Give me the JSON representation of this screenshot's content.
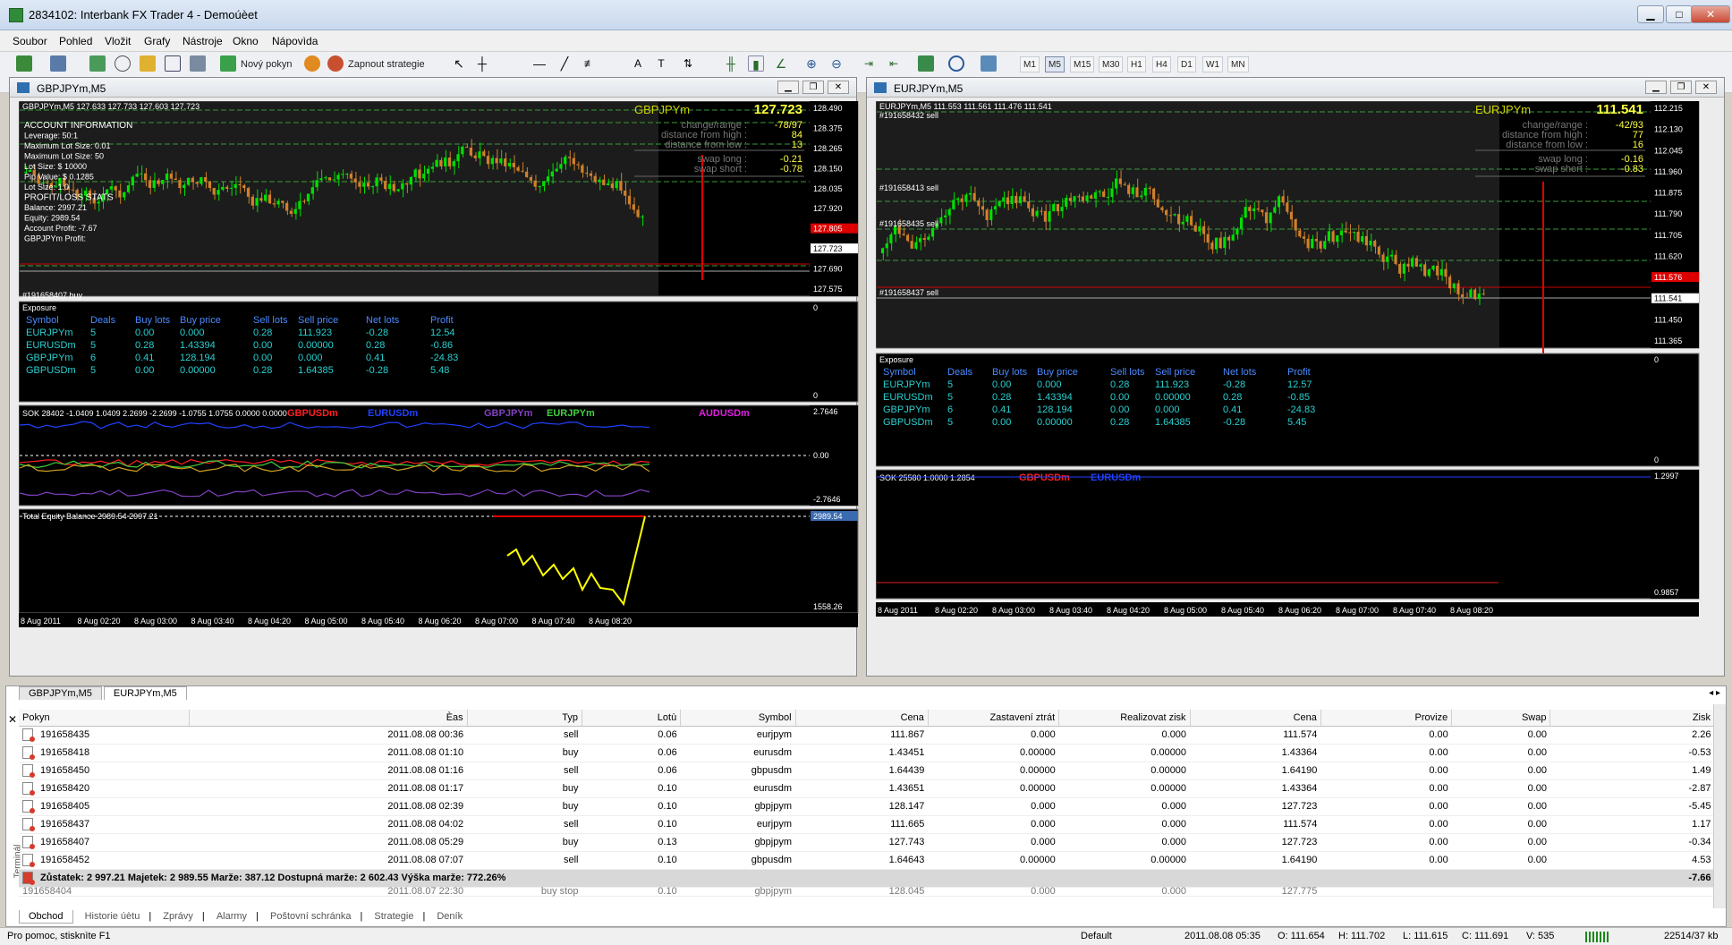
{
  "app": {
    "title": "2834102: Interbank FX Trader 4 - Demoúèet"
  },
  "menu": [
    "Soubor",
    "Pohled",
    "Vložit",
    "Grafy",
    "Nástroje",
    "Okno",
    "Nápovìda"
  ],
  "toolbar": {
    "new_order": "Nový pokyn",
    "strategies": "Zapnout strategie",
    "timeframes": [
      "M1",
      "M5",
      "M15",
      "M30",
      "H1",
      "H4",
      "D1",
      "W1",
      "MN"
    ]
  },
  "charts": [
    {
      "window_title": "GBPJPYm,M5",
      "price_header": "GBPJPYm,M5  127.633 127.733 127.603 127.723",
      "symbol": "GBPJPYm",
      "bid": "127.723",
      "stats": [
        [
          "change/range :",
          "-78/97"
        ],
        [
          "distance from high :",
          "84"
        ],
        [
          "distance from low :",
          "13"
        ],
        [
          "swap long :",
          "-0.21"
        ],
        [
          "swap short :",
          "-0.78"
        ]
      ],
      "account_info": [
        "ACCOUNT INFORMATION",
        "Leverage: 50:1",
        "Maximum Lot Size: 0.01",
        "Maximum Lot Size: 50",
        "Lot Size: $ 10000",
        "Pip Value: $ 0.1285",
        "Lot Size: 1.0",
        "PROFIT/LOSS STATS",
        "Balance: 2997.21",
        "Equity: 2989.54",
        "Account Profit: -7.67",
        "GBPJPYm Profit:"
      ],
      "order_labels": [
        "#191658407 buy"
      ],
      "price_axis": [
        "128.490",
        "128.375",
        "128.265",
        "128.150",
        "128.035",
        "127.920",
        "127.805",
        "127.723",
        "127.690",
        "127.575"
      ],
      "exposure": {
        "title": "Exposure",
        "headers": [
          "Symbol",
          "Deals",
          "Buy lots",
          "Buy price",
          "Sell lots",
          "Sell price",
          "Net lots",
          "Profit"
        ],
        "rows": [
          [
            "EURJPYm",
            "5",
            "0.00",
            "0.000",
            "0.28",
            "111.923",
            "-0.28",
            "12.54"
          ],
          [
            "EURUSDm",
            "5",
            "0.28",
            "1.43394",
            "0.00",
            "0.00000",
            "0.28",
            "-0.86"
          ],
          [
            "GBPJPYm",
            "6",
            "0.41",
            "128.194",
            "0.00",
            "0.000",
            "0.41",
            "-24.83"
          ],
          [
            "GBPUSDm",
            "5",
            "0.00",
            "0.00000",
            "0.28",
            "1.64385",
            "-0.28",
            "5.48"
          ]
        ],
        "axis": [
          "0",
          "0"
        ]
      },
      "indicator": {
        "header": "SOK 28402 -1.0409 1.0409 2.2699 -2.2699 -1.0755 1.0755 0.0000 0.0000",
        "series": [
          "GBPUSDm",
          "EURUSDm",
          "GBPJPYm",
          "EURJPYm",
          "AUDUSDm"
        ],
        "axis": [
          "2.7646",
          "0.00",
          "-2.7646"
        ]
      },
      "equity": {
        "header": "Total Equity Balance 2989.54 2997.21",
        "axis": [
          "2989.54",
          "1558.26"
        ]
      },
      "time_axis": [
        "8 Aug 2011",
        "8 Aug 02:20",
        "8 Aug 03:00",
        "8 Aug 03:40",
        "8 Aug 04:20",
        "8 Aug 05:00",
        "8 Aug 05:40",
        "8 Aug 06:20",
        "8 Aug 07:00",
        "8 Aug 07:40",
        "8 Aug 08:20"
      ]
    },
    {
      "window_title": "EURJPYm,M5",
      "price_header": "EURJPYm,M5  111.553 111.561 111.476 111.541",
      "symbol": "EURJPYm",
      "bid": "111.541",
      "stats": [
        [
          "change/range :",
          "-42/93"
        ],
        [
          "distance from high :",
          "77"
        ],
        [
          "distance from low :",
          "16"
        ],
        [
          "swap long :",
          "-0.16"
        ],
        [
          "swap short :",
          "-0.83"
        ]
      ],
      "order_labels": [
        "#191658432 sell",
        "#191658413 sell",
        "#191658435 sell",
        "#191658437 sell"
      ],
      "price_axis": [
        "112.215",
        "112.130",
        "112.045",
        "111.960",
        "111.875",
        "111.790",
        "111.705",
        "111.620",
        "111.576",
        "111.541",
        "111.450",
        "111.365"
      ],
      "exposure": {
        "title": "Exposure",
        "headers": [
          "Symbol",
          "Deals",
          "Buy lots",
          "Buy price",
          "Sell lots",
          "Sell price",
          "Net lots",
          "Profit"
        ],
        "rows": [
          [
            "EURJPYm",
            "5",
            "0.00",
            "0.000",
            "0.28",
            "111.923",
            "-0.28",
            "12.57"
          ],
          [
            "EURUSDm",
            "5",
            "0.28",
            "1.43394",
            "0.00",
            "0.00000",
            "0.28",
            "-0.85"
          ],
          [
            "GBPJPYm",
            "6",
            "0.41",
            "128.194",
            "0.00",
            "0.000",
            "0.41",
            "-24.83"
          ],
          [
            "GBPUSDm",
            "5",
            "0.00",
            "0.00000",
            "0.28",
            "1.64385",
            "-0.28",
            "5.45"
          ]
        ],
        "axis": [
          "0",
          "0"
        ]
      },
      "indicator": {
        "header": "SOK 25580 1.0000 1.2854",
        "series": [
          "GBPUSDm",
          "EURUSDm"
        ],
        "axis": [
          "1.2997",
          "0.9857"
        ]
      },
      "time_axis": [
        "8 Aug 2011",
        "8 Aug 02:20",
        "8 Aug 03:00",
        "8 Aug 03:40",
        "8 Aug 04:20",
        "8 Aug 05:00",
        "8 Aug 05:40",
        "8 Aug 06:20",
        "8 Aug 07:00",
        "8 Aug 07:40",
        "8 Aug 08:20"
      ]
    }
  ],
  "chart_tabs": [
    "GBPJPYm,M5",
    "EURJPYm,M5"
  ],
  "terminal": {
    "headers": [
      "Pokyn",
      "Èas",
      "Typ",
      "Lotù",
      "Symbol",
      "Cena",
      "Zastavení ztrát",
      "Realizovat zisk",
      "Cena",
      "Provize",
      "Swap",
      "Zisk"
    ],
    "rows": [
      [
        "191658435",
        "2011.08.08 00:36",
        "sell",
        "0.06",
        "eurjpym",
        "111.867",
        "0.000",
        "0.000",
        "111.574",
        "0.00",
        "0.00",
        "2.26"
      ],
      [
        "191658418",
        "2011.08.08 01:10",
        "buy",
        "0.06",
        "eurusdm",
        "1.43451",
        "0.00000",
        "0.00000",
        "1.43364",
        "0.00",
        "0.00",
        "-0.53"
      ],
      [
        "191658450",
        "2011.08.08 01:16",
        "sell",
        "0.06",
        "gbpusdm",
        "1.64439",
        "0.00000",
        "0.00000",
        "1.64190",
        "0.00",
        "0.00",
        "1.49"
      ],
      [
        "191658420",
        "2011.08.08 01:17",
        "buy",
        "0.10",
        "eurusdm",
        "1.43651",
        "0.00000",
        "0.00000",
        "1.43364",
        "0.00",
        "0.00",
        "-2.87"
      ],
      [
        "191658405",
        "2011.08.08 02:39",
        "buy",
        "0.10",
        "gbpjpym",
        "128.147",
        "0.000",
        "0.000",
        "127.723",
        "0.00",
        "0.00",
        "-5.45"
      ],
      [
        "191658437",
        "2011.08.08 04:02",
        "sell",
        "0.10",
        "eurjpym",
        "111.665",
        "0.000",
        "0.000",
        "111.574",
        "0.00",
        "0.00",
        "1.17"
      ],
      [
        "191658407",
        "2011.08.08 05:29",
        "buy",
        "0.13",
        "gbpjpym",
        "127.743",
        "0.000",
        "0.000",
        "127.723",
        "0.00",
        "0.00",
        "-0.34"
      ],
      [
        "191658452",
        "2011.08.08 07:07",
        "sell",
        "0.10",
        "gbpusdm",
        "1.64643",
        "0.00000",
        "0.00000",
        "1.64190",
        "0.00",
        "0.00",
        "4.53"
      ]
    ],
    "summary": "Zůstatek: 2 997.21  Majetek: 2 989.55  Marže: 387.12  Dostupná marže: 2 602.43  Výška marže: 772.26%",
    "summary_total": "-7.66",
    "partial_row": [
      "191658404",
      "2011.08.07 22:30",
      "buy stop",
      "0.10",
      "gbpjpym",
      "128.045",
      "0.000",
      "0.000",
      "127.775",
      "",
      "",
      ""
    ],
    "tabs": [
      "Obchod",
      "Historie úètu",
      "Zprávy",
      "Alarmy",
      "Poštovní schránka",
      "Strategie",
      "Deník"
    ],
    "side_label": "Terminál"
  },
  "status": {
    "help": "Pro pomoc, stisknìte F1",
    "profile": "Default",
    "time": "2011.08.08 05:35",
    "open": "O: 111.654",
    "high": "H: 111.702",
    "low": "L: 111.615",
    "close": "C: 111.691",
    "volume": "V: 535",
    "traffic": "22514/37 kb"
  },
  "colors": {
    "bull": "#00e000",
    "bear": "#d0802a",
    "grid": "#3a7a3a",
    "red": "#ff0000",
    "yellow": "#ffff00"
  }
}
